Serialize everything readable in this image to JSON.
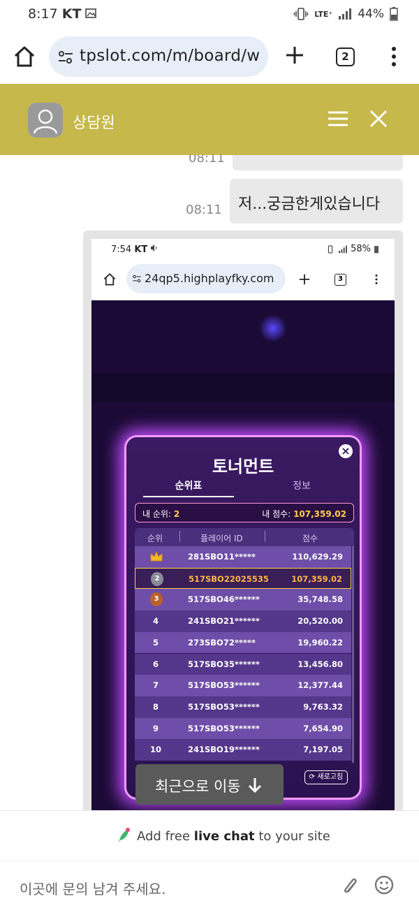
{
  "status_bar": {
    "time": "8:17",
    "carrier": "KT",
    "network": "LTE⁺",
    "battery": "44%"
  },
  "browser": {
    "url": "tpslot.com/m/board/w",
    "tab_count": "2"
  },
  "chat_header": {
    "agent_name": "상담원"
  },
  "messages": [
    {
      "time": "08:11",
      "text": ""
    },
    {
      "time": "08:11",
      "text": "저...궁금한게있습니다"
    }
  ],
  "screenshot": {
    "status_time": "7:54",
    "status_carrier": "KT",
    "status_battery": "58%",
    "url": "24qp5.highplayfky.com",
    "tab_count": "3",
    "modal": {
      "title": "토너먼트",
      "tab_rank": "순위표",
      "tab_info": "정보",
      "my_rank_label": "내 순위:",
      "my_rank_value": "2",
      "my_score_label": "내 점수:",
      "my_score_value": "107,359.02",
      "headers": {
        "rank": "순위",
        "player": "플레이어 ID",
        "score": "점수"
      },
      "rows": [
        {
          "rank": "1",
          "player": "281SBO11*****",
          "score": "110,629.29"
        },
        {
          "rank": "2",
          "player": "517SBO22025535",
          "score": "107,359.02"
        },
        {
          "rank": "3",
          "player": "517SBO46******",
          "score": "35,748.58"
        },
        {
          "rank": "4",
          "player": "241SBO21******",
          "score": "20,520.00"
        },
        {
          "rank": "5",
          "player": "273SBO72*****",
          "score": "19,960.22"
        },
        {
          "rank": "6",
          "player": "517SBO35******",
          "score": "13,456.80"
        },
        {
          "rank": "7",
          "player": "517SBO53******",
          "score": "12,377.44"
        },
        {
          "rank": "8",
          "player": "517SBO53******",
          "score": "9,763.32"
        },
        {
          "rank": "9",
          "player": "517SBO53******",
          "score": "7,654.90"
        },
        {
          "rank": "10",
          "player": "241SBO19******",
          "score": "7,197.05"
        }
      ],
      "refresh_label": "새로고침"
    }
  },
  "recent_button": {
    "label": "최근으로 이동"
  },
  "promo": {
    "prefix": "Add free ",
    "bold": "live chat",
    "suffix": " to your site"
  },
  "input": {
    "placeholder": "이곳에 문의 남겨 주세요."
  },
  "colors": {
    "header_bg": "#c6b84a",
    "bubble_bg": "#e9e9e9",
    "modal_glow": "#c24dff"
  }
}
